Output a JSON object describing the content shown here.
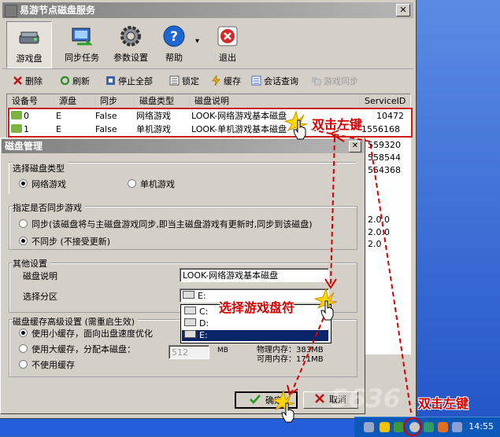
{
  "main_window": {
    "title": "易游节点磁盘服务",
    "close_glyph": "✕",
    "big_toolbar": [
      {
        "label": "游戏盘",
        "icon": "disk-icon",
        "selected": true
      },
      {
        "label": "同步任务",
        "icon": "sync-task-icon",
        "selected": false
      },
      {
        "label": "参数设置",
        "icon": "gear-icon",
        "selected": false
      },
      {
        "label": "帮助",
        "icon": "help-icon",
        "selected": false
      },
      {
        "label": "退出",
        "icon": "exit-icon",
        "selected": false
      }
    ],
    "dropdown_arrow": "▾",
    "small_toolbar": [
      {
        "label": "删除",
        "icon": "delete-x-icon",
        "enabled": true
      },
      {
        "label": "刷新",
        "icon": "refresh-icon",
        "enabled": true
      },
      {
        "label": "停止全部",
        "icon": "stop-icon",
        "enabled": true
      },
      {
        "label": "锁定",
        "icon": "lock-icon",
        "enabled": true
      },
      {
        "label": "缓存",
        "icon": "cache-icon",
        "enabled": true
      },
      {
        "label": "会话查询",
        "icon": "session-query-icon",
        "enabled": true
      },
      {
        "label": "游戏同步",
        "icon": "game-sync-icon",
        "enabled": false
      }
    ],
    "list_columns": [
      "设备号",
      "源盘",
      "同步",
      "磁盘类型",
      "磁盘说明",
      "ServiceID"
    ],
    "list_rows": [
      {
        "device": "0",
        "source": "E",
        "sync": "False",
        "type": "网络游戏",
        "desc": "LOOK-网络游戏基本磁盘",
        "service_id": "10472"
      },
      {
        "device": "1",
        "source": "E",
        "sync": "False",
        "type": "单机游戏",
        "desc": "LOOK-单机游戏基本磁盘",
        "service_id": "1556168"
      }
    ],
    "list_partial_ids": [
      "559320",
      "558544",
      "554368"
    ],
    "list_partial_misc": [
      "2.0.0",
      "2.0.0",
      "2.0"
    ]
  },
  "dialog": {
    "title": "磁盘管理",
    "close_glyph": "✕",
    "disk_type_group": {
      "title": "选择磁盘类型",
      "options": [
        "网络游戏",
        "单机游戏"
      ],
      "selected": 0
    },
    "sync_group": {
      "title": "指定是否同步游戏",
      "options": [
        "同步(该磁盘将与主磁盘游戏同步,即当主磁盘游戏有更新时,同步到该磁盘)",
        "不同步 (不接受更新)"
      ],
      "selected": 1
    },
    "other_group": {
      "title": "其他设置",
      "desc_label": "磁盘说明",
      "desc_value": "LOOK-网络游戏基本磁盘",
      "partition_label": "选择分区",
      "partition_value": "E:",
      "partition_options": [
        "C:",
        "D:",
        "E:"
      ],
      "partition_selected": 2
    },
    "cache_group": {
      "title": "磁盘缓存高级设置 (需重启生效)",
      "options": [
        "使用小缓存，面向出盘速度优化",
        "使用大缓存，分配本磁盘：",
        "不使用缓存"
      ],
      "selected": 0,
      "cache_size": "512",
      "cache_unit": "MB",
      "physical_memory": "物理内存：383MB",
      "available_memory": "可用内存：171MB"
    },
    "ok_label": "确定",
    "cancel_label": "取消"
  },
  "annotations": {
    "double_click_top": "双击左键",
    "select_drive": "选择游戏盘符",
    "double_click_tray": "双击左键"
  },
  "taskbar": {
    "clock": "14:55",
    "watermark": "5636"
  },
  "colors": {
    "window_bg": "#d4d0c8",
    "title_gray": "#808080",
    "annotation_red": "#d40000",
    "selection_blue": "#0a246a",
    "taskbar_blue": "#0c59b9"
  }
}
